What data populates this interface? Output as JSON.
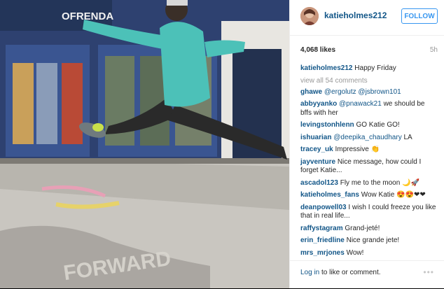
{
  "post": {
    "sign_text": "OFRENDA",
    "chalk_text": "FORWARD"
  },
  "header": {
    "username": "katieholmes212",
    "follow_label": "FOLLOW"
  },
  "stats": {
    "likes": "4,068 likes",
    "time_ago": "5h"
  },
  "caption": {
    "user": "katieholmes212",
    "text": "Happy Friday"
  },
  "view_all": "view all 54 comments",
  "comments": [
    {
      "user": "ghawe",
      "mention": "@ergolutz @jsbrown101",
      "text": ""
    },
    {
      "user": "abbyyanko",
      "mention": "@pnawack21",
      "text": "we should be bffs with her"
    },
    {
      "user": "levingstonhlenn",
      "mention": "",
      "text": "GO Katie GO!"
    },
    {
      "user": "ishuarian",
      "mention": "@deepika_chaudhary",
      "text": "LA"
    },
    {
      "user": "tracey_uk",
      "mention": "",
      "text": "Impressive 👏"
    },
    {
      "user": "jayventure",
      "mention": "",
      "text": "Nice message, how could I forget Katie..."
    },
    {
      "user": "ascadol123",
      "mention": "",
      "text": "Fly me to the moon 🌙🚀"
    },
    {
      "user": "katieholmes_fans",
      "mention": "",
      "text": "Wow Katie 😍😍❤❤"
    },
    {
      "user": "deanpowell03",
      "mention": "",
      "text": "I wish I could freeze you like that in real life..."
    },
    {
      "user": "raffystagram",
      "mention": "",
      "text": "Grand-jeté!"
    },
    {
      "user": "erin_friedline",
      "mention": "",
      "text": "Nice grande jete!"
    },
    {
      "user": "mrs_mrjones",
      "mention": "",
      "text": "Wow!"
    }
  ],
  "footer": {
    "login_link": "Log in",
    "login_rest": " to like or comment.",
    "more_label": "•••"
  },
  "colors": {
    "link_blue": "#125688",
    "follow_blue": "#3897f0",
    "muted": "#999999",
    "storefront_blue": "#2e4170",
    "hoodie_teal": "#4cc1b8"
  }
}
